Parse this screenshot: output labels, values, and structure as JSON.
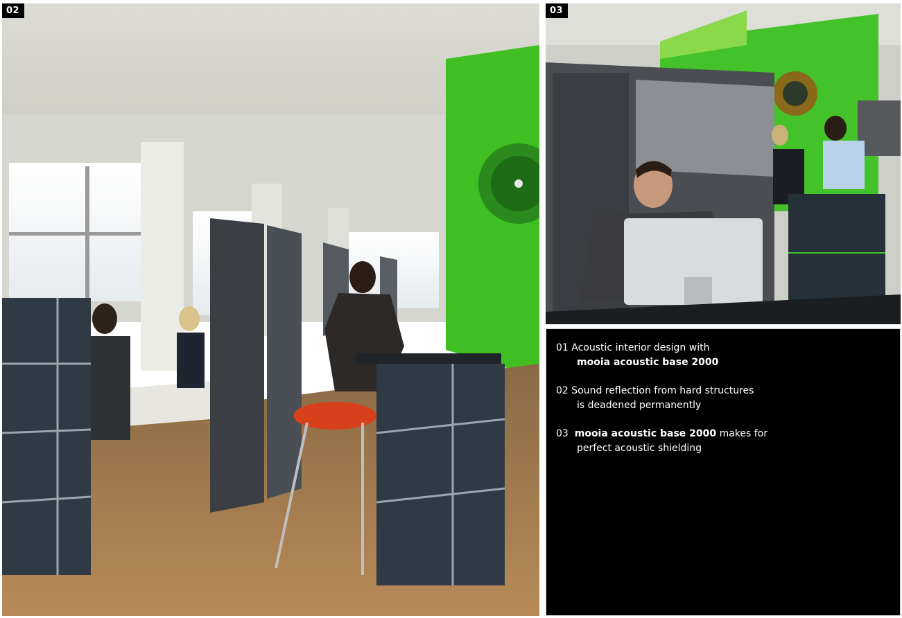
{
  "photos": {
    "left": {
      "label": "02"
    },
    "right": {
      "label": "03"
    }
  },
  "captions": [
    {
      "num": "01",
      "line1": "Acoustic interior design with",
      "line2_bold": "mooia acoustic base 2000"
    },
    {
      "num": "02",
      "line1": "Sound reflection from hard structures",
      "line2": "is deadened permanently"
    },
    {
      "num": "03",
      "line1_bold": "mooia acoustic base 2000",
      "line1_rest": " makes for",
      "line2": "perfect acoustic shielding"
    }
  ]
}
